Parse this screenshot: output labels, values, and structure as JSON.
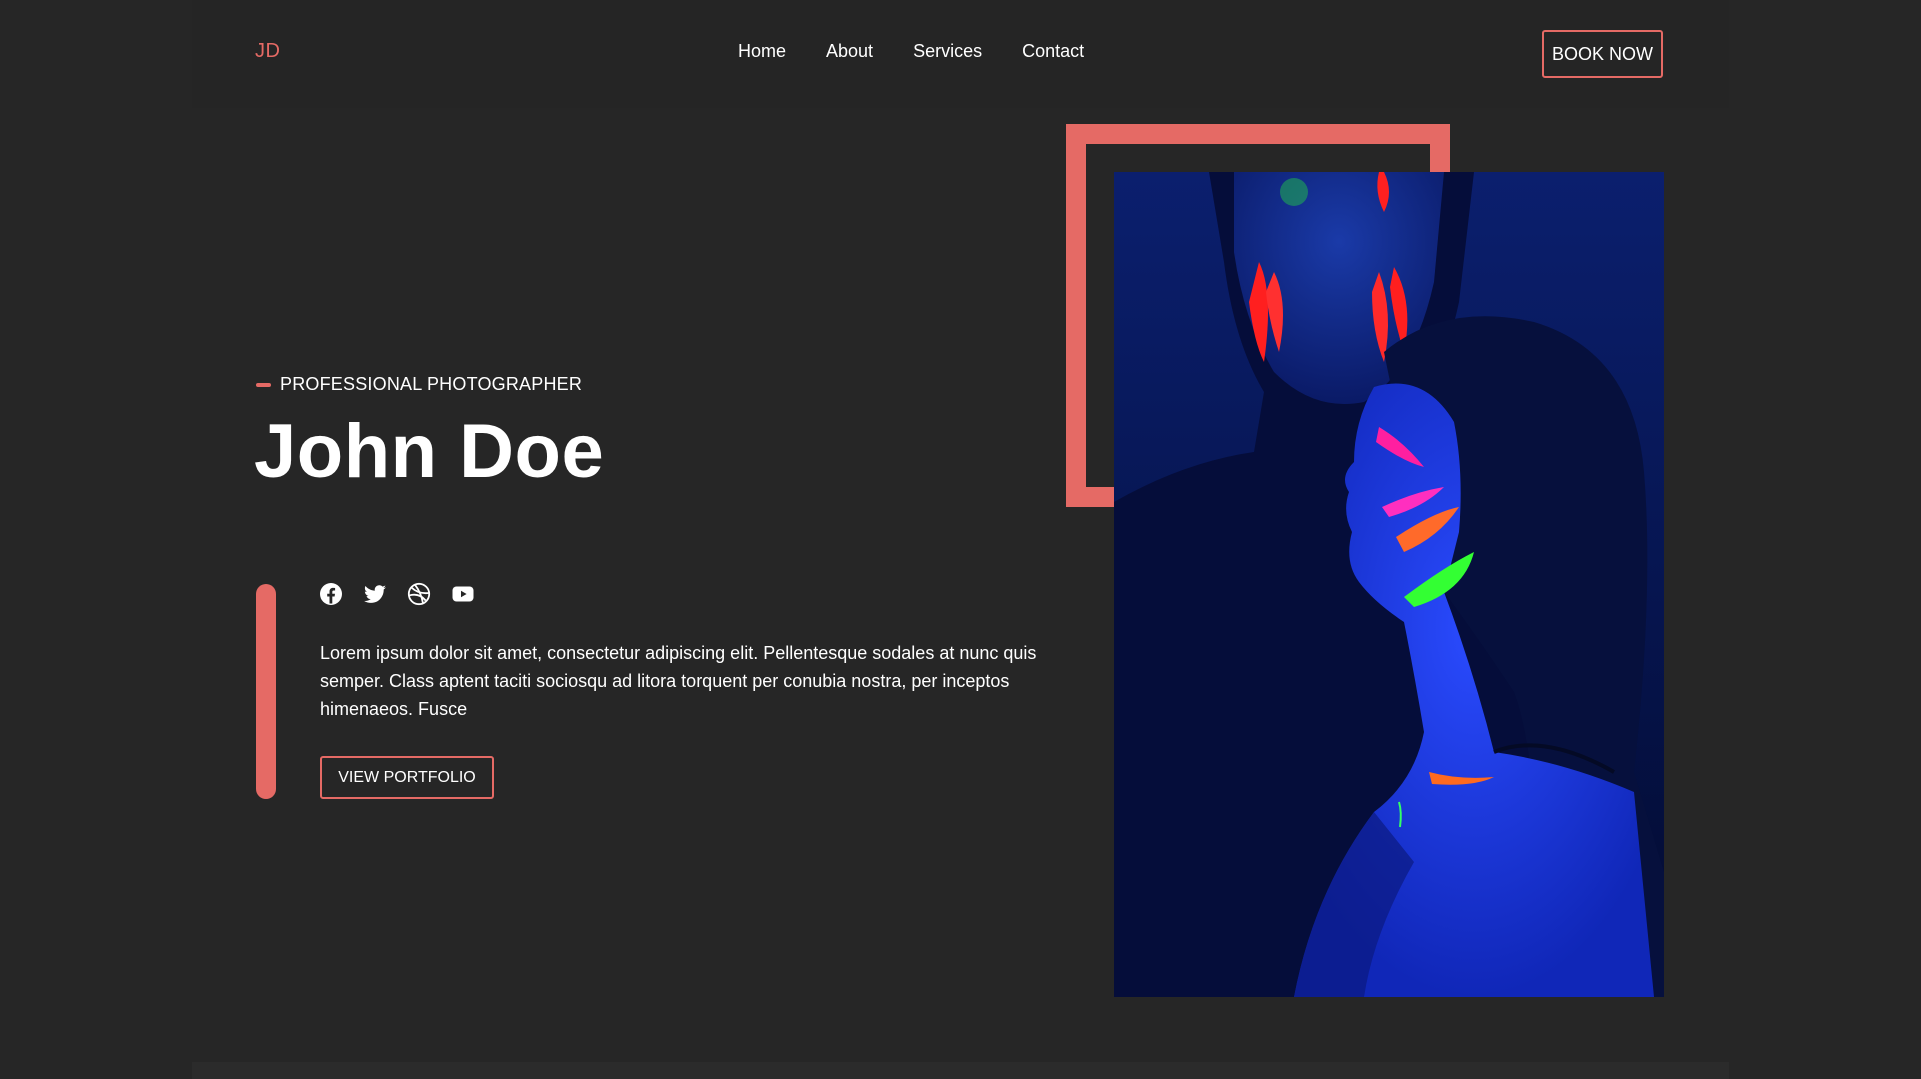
{
  "header": {
    "logo": "JD",
    "nav": [
      "Home",
      "About",
      "Services",
      "Contact"
    ],
    "cta_label": "BOOK NOW"
  },
  "hero": {
    "tagline": "PROFESSIONAL PHOTOGRAPHER",
    "name": "John Doe",
    "description": "Lorem ipsum dolor sit amet, consectetur adipiscing elit. Pellentesque sodales at nunc quis semper. Class aptent taciti sociosqu ad litora torquent per conubia nostra, per inceptos himenaeos. Fusce",
    "portfolio_label": "VIEW PORTFOLIO",
    "socials": [
      "facebook-icon",
      "twitter-icon",
      "dribbble-icon",
      "youtube-icon"
    ]
  },
  "colors": {
    "background": "#262626",
    "accent": "#e56a65",
    "text": "#ffffff"
  }
}
